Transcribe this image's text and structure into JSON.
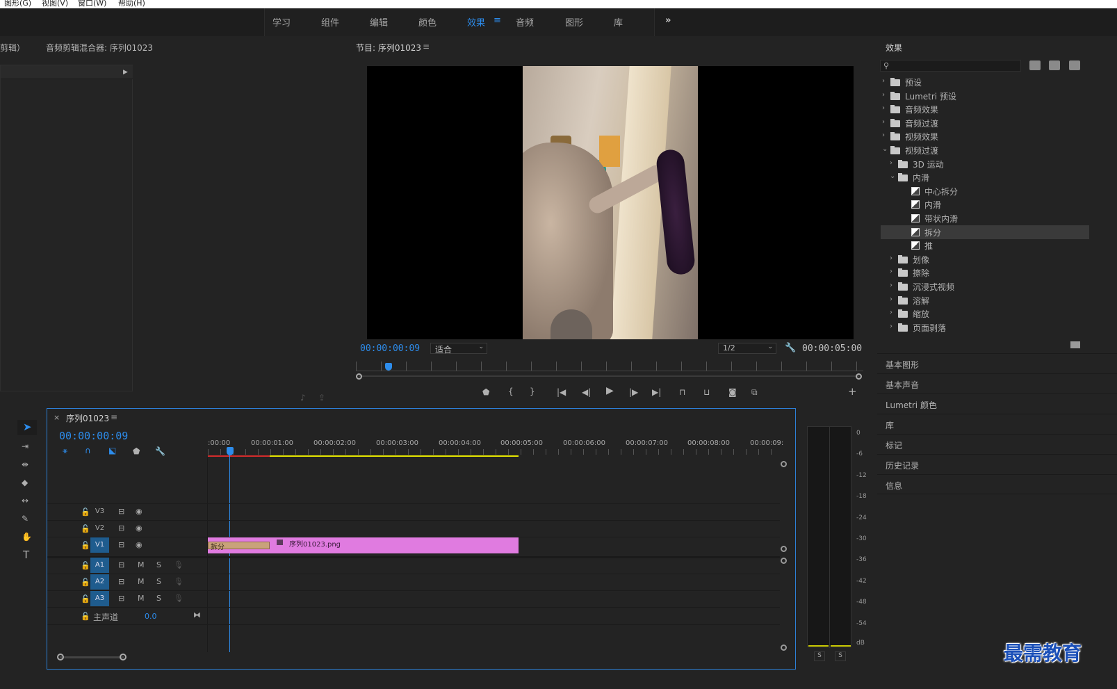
{
  "menubar": {
    "items": [
      "图形(G)",
      "视图(V)",
      "窗口(W)",
      "帮助(H)"
    ]
  },
  "workspaces": {
    "tabs": [
      "学习",
      "组件",
      "编辑",
      "颜色",
      "效果",
      "音频",
      "图形",
      "库"
    ],
    "active": "效果",
    "overflow": "»"
  },
  "source_panel": {
    "tab_partial": "剪辑）",
    "title": "音频剪辑混合器: 序列01023"
  },
  "program_monitor": {
    "title": "节目: 序列01023",
    "timecode_current": "00:00:00:09",
    "fit_option": "适合",
    "resolution": "1/2",
    "timecode_duration": "00:00:05:00",
    "playhead_fraction": 0.064
  },
  "effects_panel": {
    "title": "效果",
    "search_placeholder": "",
    "filter_icons": [
      "32bit-icon",
      "yuv-icon"
    ],
    "tree": [
      {
        "label": "预设",
        "level": 0,
        "kind": "preset-folder",
        "expanded": false
      },
      {
        "label": "Lumetri 预设",
        "level": 0,
        "kind": "preset-folder",
        "expanded": false
      },
      {
        "label": "音频效果",
        "level": 0,
        "kind": "folder",
        "expanded": false
      },
      {
        "label": "音频过渡",
        "level": 0,
        "kind": "folder",
        "expanded": false
      },
      {
        "label": "视频效果",
        "level": 0,
        "kind": "folder",
        "expanded": false
      },
      {
        "label": "视频过渡",
        "level": 0,
        "kind": "folder",
        "expanded": true
      },
      {
        "label": "3D 运动",
        "level": 1,
        "kind": "folder",
        "expanded": false
      },
      {
        "label": "内滑",
        "level": 1,
        "kind": "folder",
        "expanded": true
      },
      {
        "label": "中心拆分",
        "level": 2,
        "kind": "transition"
      },
      {
        "label": "内滑",
        "level": 2,
        "kind": "transition"
      },
      {
        "label": "带状内滑",
        "level": 2,
        "kind": "transition"
      },
      {
        "label": "拆分",
        "level": 2,
        "kind": "transition",
        "selected": true
      },
      {
        "label": "推",
        "level": 2,
        "kind": "transition"
      },
      {
        "label": "划像",
        "level": 1,
        "kind": "folder",
        "expanded": false
      },
      {
        "label": "擦除",
        "level": 1,
        "kind": "folder",
        "expanded": false
      },
      {
        "label": "沉浸式视频",
        "level": 1,
        "kind": "folder",
        "expanded": false
      },
      {
        "label": "溶解",
        "level": 1,
        "kind": "folder",
        "expanded": false
      },
      {
        "label": "缩放",
        "level": 1,
        "kind": "folder",
        "expanded": false
      },
      {
        "label": "页面剥落",
        "level": 1,
        "kind": "folder",
        "expanded": false
      }
    ]
  },
  "side_panels": [
    "基本图形",
    "基本声音",
    "Lumetri 颜色",
    "库",
    "标记",
    "历史记录",
    "信息"
  ],
  "timeline": {
    "tab_close": "×",
    "title": "序列01023",
    "timecode": "00:00:00:09",
    "ruler": [
      ":00:00",
      "00:00:01:00",
      "00:00:02:00",
      "00:00:03:00",
      "00:00:04:00",
      "00:00:05:00",
      "00:00:06:00",
      "00:00:07:00",
      "00:00:08:00",
      "00:00:09:"
    ],
    "video_tracks": [
      "V3",
      "V2",
      "V1"
    ],
    "audio_tracks": [
      "A1",
      "A2",
      "A3"
    ],
    "mute_label": "M",
    "solo_label": "S",
    "master": {
      "label": "主声道",
      "value": "0.0"
    },
    "clip": {
      "name": "序列01023.png",
      "transition": "拆分"
    }
  },
  "audio_meter": {
    "scale": [
      "0",
      "-6",
      "-12",
      "-18",
      "-24",
      "-30",
      "-36",
      "-42",
      "-48",
      "-54",
      "dB"
    ],
    "solo": [
      "S",
      "S"
    ]
  },
  "watermark": "最需教育",
  "colors": {
    "accent": "#2d8ceb",
    "clip": "#e07be0",
    "transition": "#c9a27a",
    "workarea": "#e6e600",
    "render_red": "#d42b2b"
  }
}
